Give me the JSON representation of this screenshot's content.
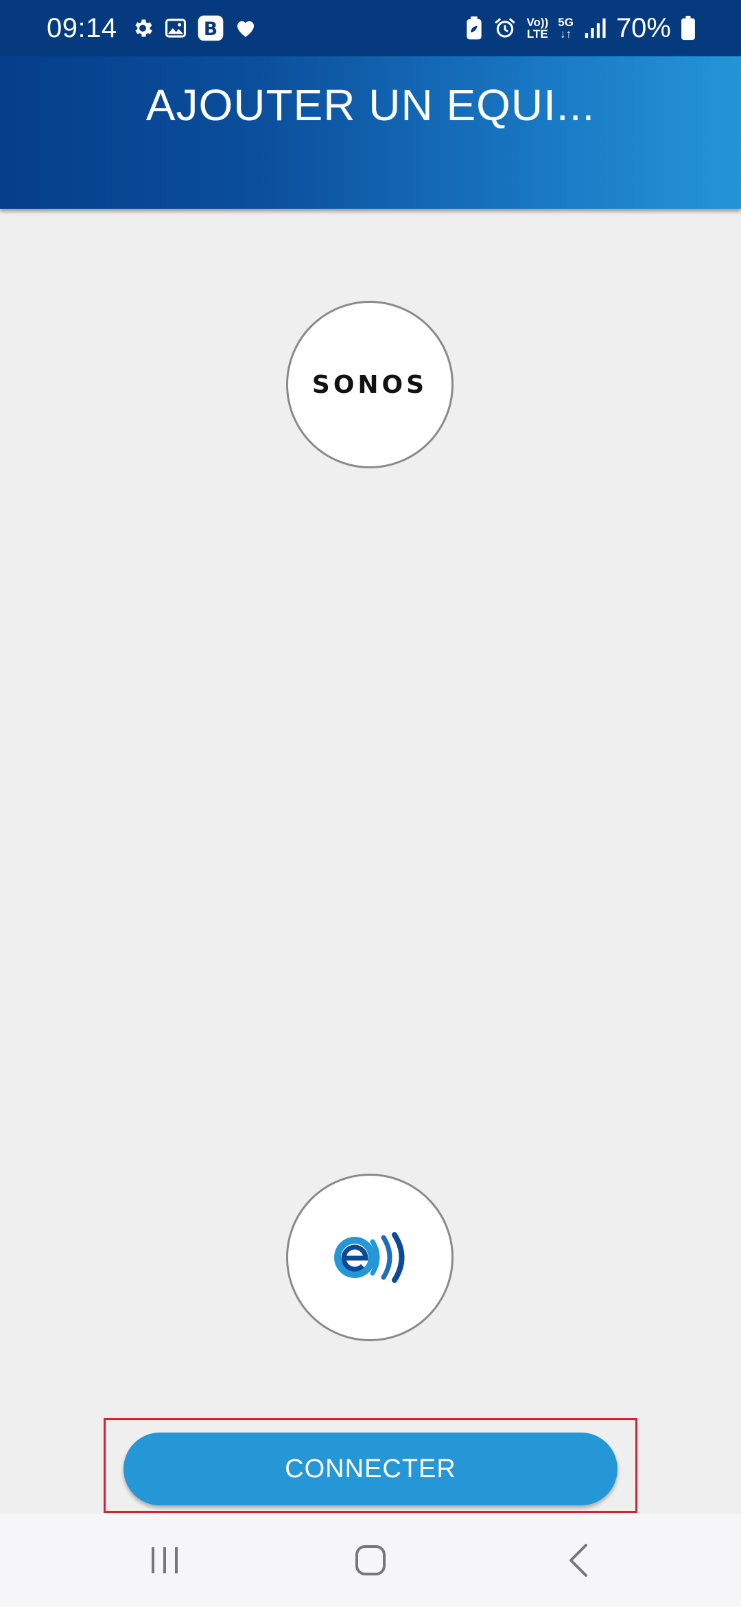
{
  "status_bar": {
    "time": "09:14",
    "battery_percent": "70%",
    "left_icons": [
      "gear-icon",
      "gallery-icon",
      "b-app-icon",
      "heart-icon"
    ],
    "right_icons": [
      "battery-saver-icon",
      "alarm-icon",
      "volte-icon",
      "5g-icon",
      "signal-icon",
      "battery-icon"
    ],
    "volte_top": "Vo))",
    "volte_bottom": "LTE",
    "network_type": "5G"
  },
  "header": {
    "title": "AJOUTER UN EQUI..."
  },
  "devices": [
    {
      "label": "SONOS",
      "logo": "sonos-logo"
    },
    {
      "label": "",
      "logo": "ecosystem-e-wave-logo"
    }
  ],
  "connect_button": {
    "label": "CONNECTER"
  },
  "colors": {
    "status_bar": "#053a7e",
    "header_start": "#053e8a",
    "header_end": "#2595d6",
    "button": "#2596d6",
    "highlight_frame": "#d7232f",
    "background": "#efefef"
  },
  "nav_bar": {
    "icons": [
      "recent-apps-icon",
      "home-icon",
      "back-icon"
    ]
  }
}
